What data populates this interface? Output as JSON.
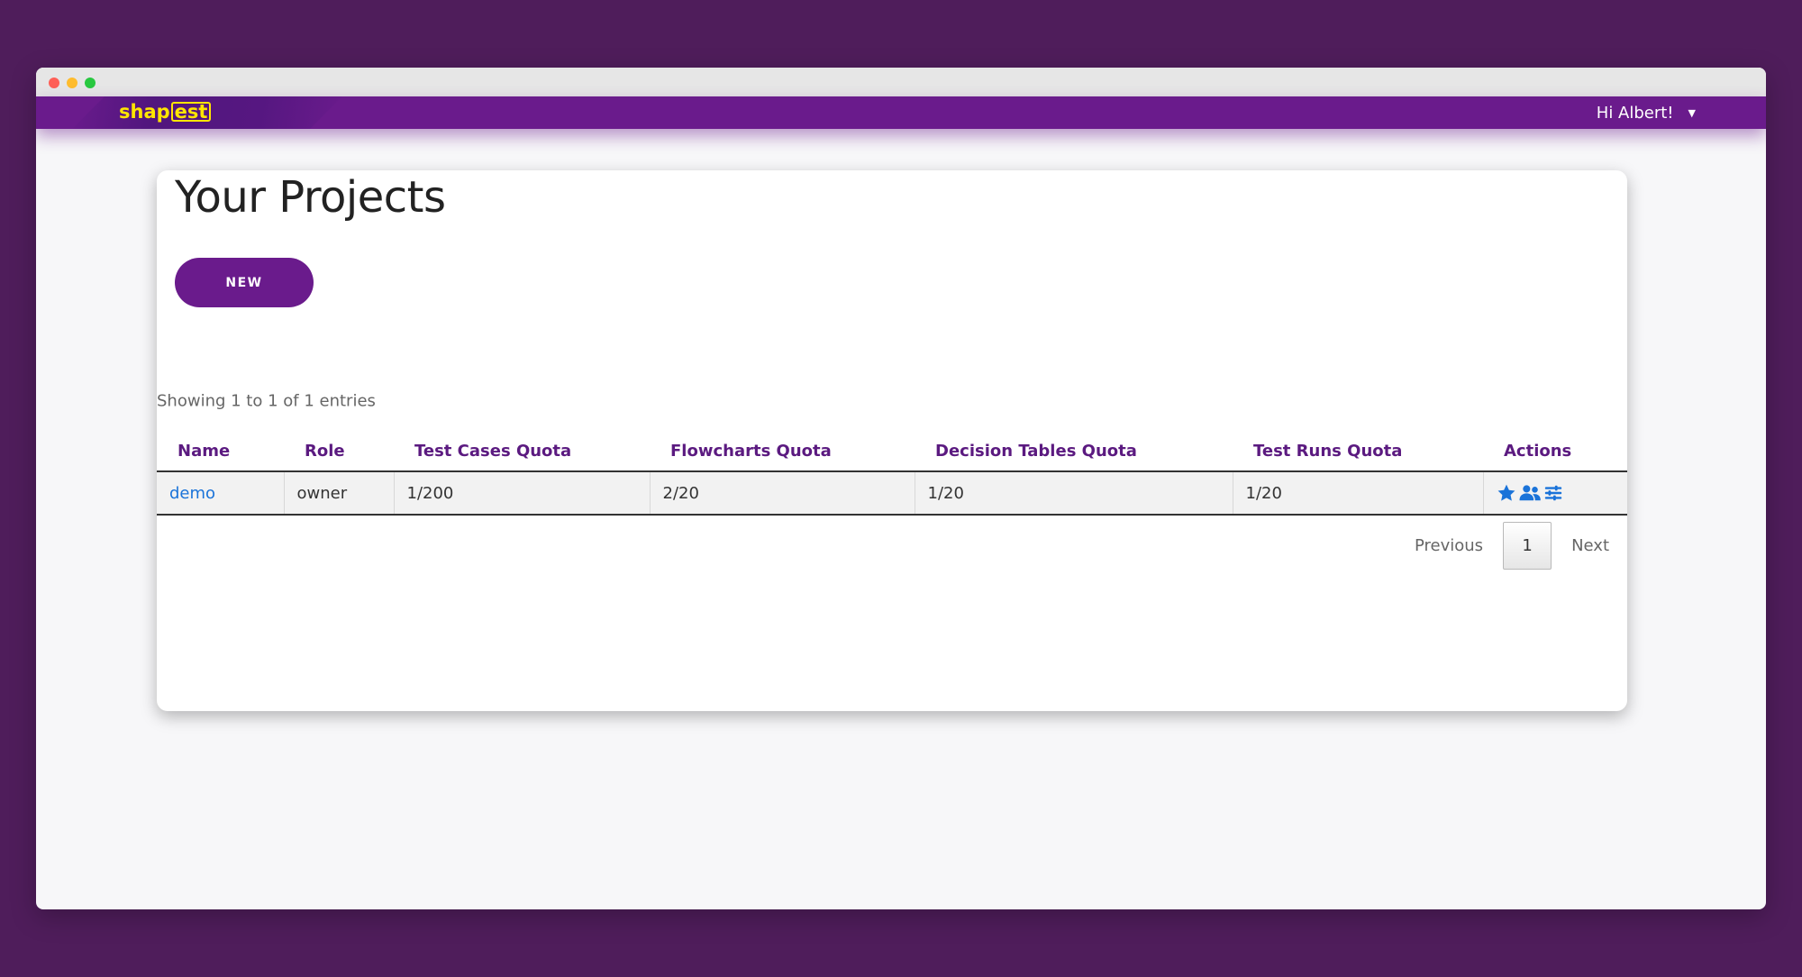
{
  "header": {
    "brand_prefix": "shap",
    "brand_boxed": "est",
    "greeting": "Hi Albert!",
    "caret": "▼"
  },
  "main": {
    "title": "Your Projects",
    "new_button": "NEW",
    "entries_info": "Showing 1 to 1 of 1 entries",
    "table": {
      "columns": [
        "Name",
        "Role",
        "Test Cases Quota",
        "Flowcharts Quota",
        "Decision Tables Quota",
        "Test Runs Quota",
        "Actions"
      ],
      "rows": [
        {
          "name": "demo",
          "role": "owner",
          "test_cases_quota": "1/200",
          "flowcharts_quota": "2/20",
          "decision_tables_quota": "1/20",
          "test_runs_quota": "1/20",
          "actions": [
            "star-icon",
            "users-icon",
            "sliders-icon"
          ]
        }
      ]
    },
    "pagination": {
      "previous": "Previous",
      "current": "1",
      "next": "Next"
    }
  },
  "colors": {
    "background": "#4f1d5b",
    "brand_purple": "#6a1b8c",
    "brand_yellow": "#ffe600",
    "link_blue": "#1a73d9",
    "header_text": "#5b1a80"
  }
}
